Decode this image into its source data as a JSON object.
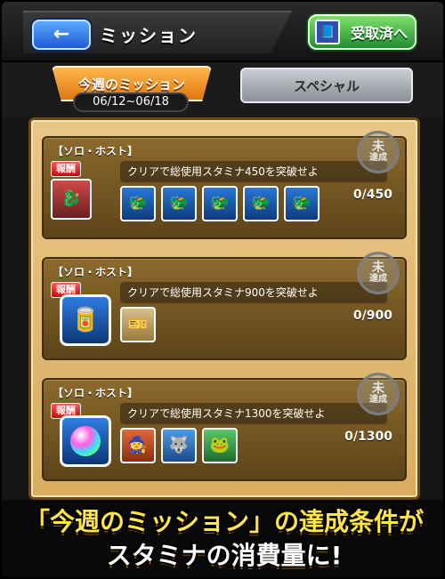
{
  "header": {
    "back_icon": "←",
    "title": "ミッション",
    "received_label": "受取済へ",
    "received_icon": "📘"
  },
  "tabs": {
    "weekly_label": "今週のミッション",
    "date_range": "06/12~06/18",
    "special_label": "スペシャル"
  },
  "missions": [
    {
      "tag": "【ソロ・ホスト】",
      "reward_label": "報酬",
      "text": "クリアで総使用スタミナ450を突破せよ",
      "progress": "0/450",
      "stamp_big": "未",
      "stamp_small": "達成",
      "reward_icons": [
        "monster-icon",
        "monster-icon",
        "monster-icon",
        "monster-icon",
        "monster-icon",
        "monster-icon"
      ]
    },
    {
      "tag": "【ソロ・ホスト】",
      "reward_label": "報酬",
      "text": "クリアで総使用スタミナ900を突破せよ",
      "progress": "0/900",
      "stamp_big": "未",
      "stamp_small": "達成",
      "reward_icons": [
        "ticket-icon"
      ]
    },
    {
      "tag": "【ソロ・ホスト】",
      "reward_label": "報酬",
      "text": "クリアで総使用スタミナ1300を突破せよ",
      "progress": "0/1300",
      "stamp_big": "未",
      "stamp_small": "達成",
      "reward_icons": [
        "monster-icon",
        "monster-icon",
        "monster-icon"
      ]
    }
  ],
  "caption": {
    "line1": "「今週のミッション」の達成条件が",
    "line2": "スタミナの消費量に!"
  }
}
